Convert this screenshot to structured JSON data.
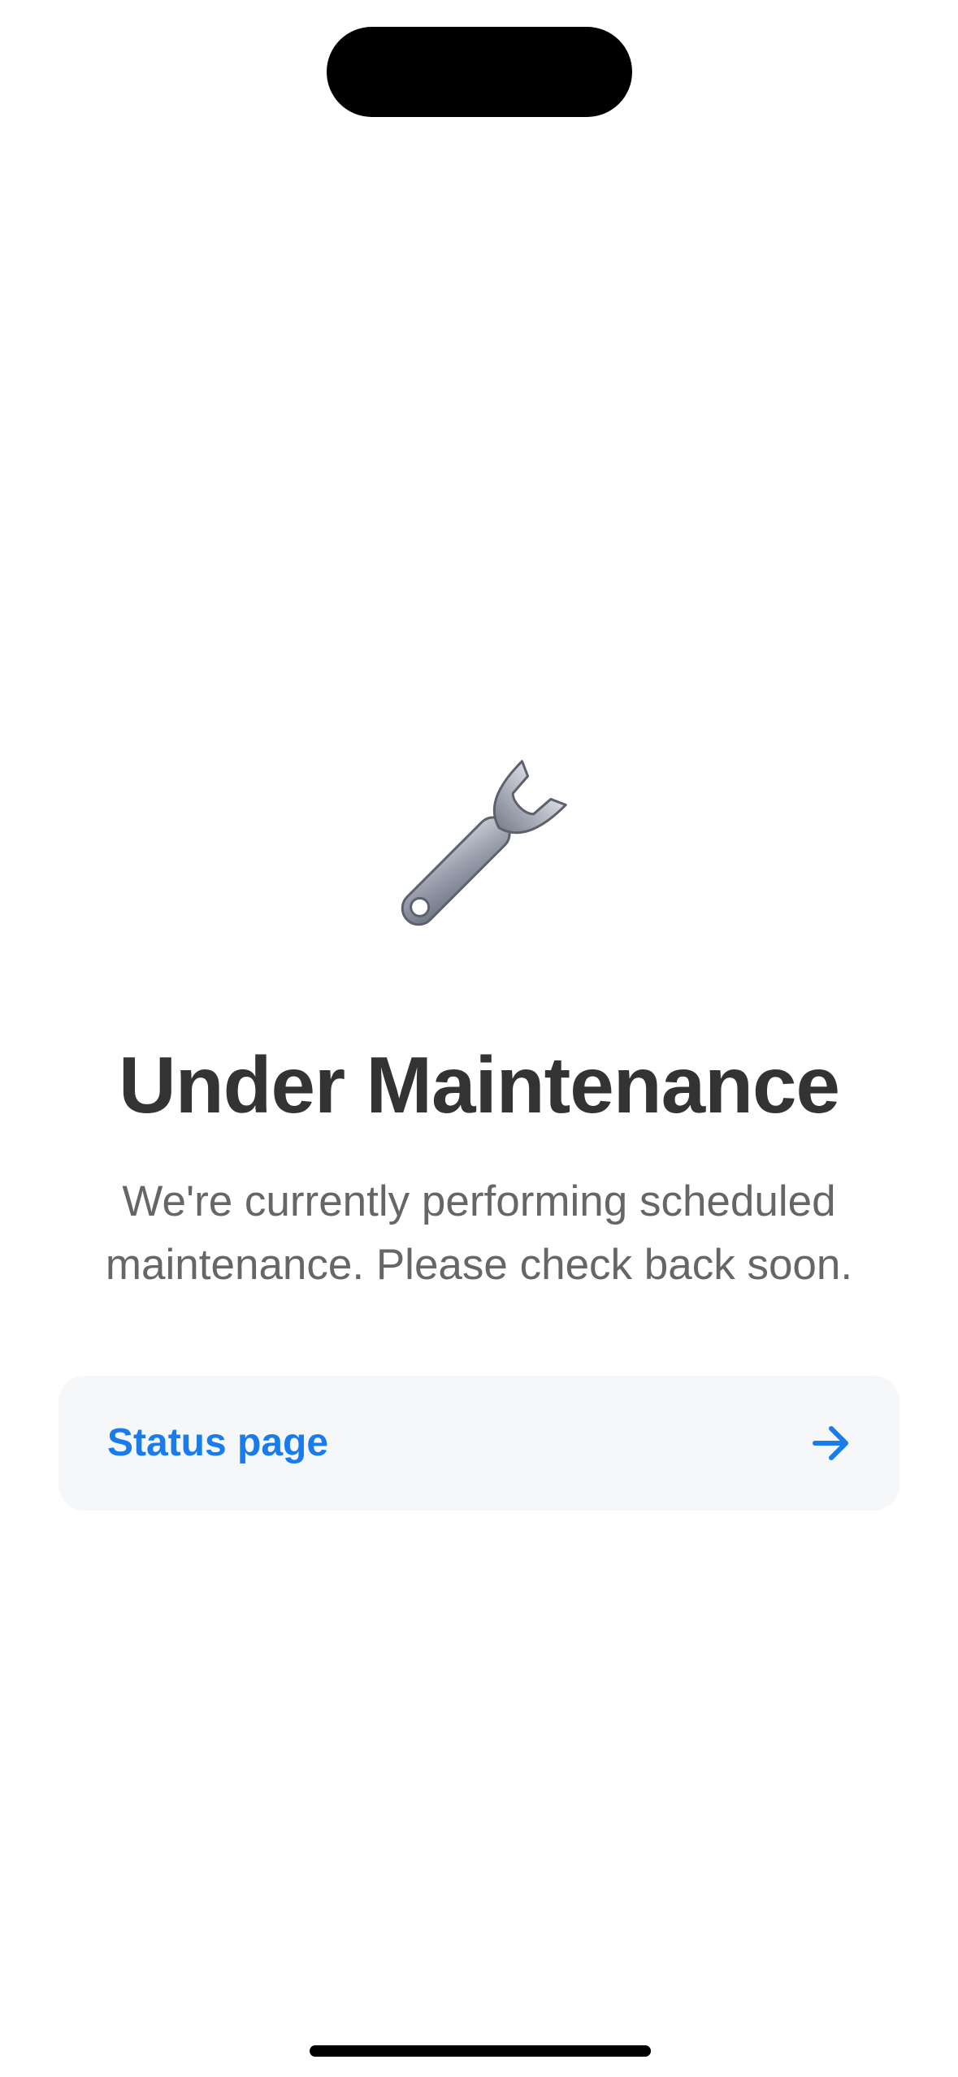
{
  "maintenance": {
    "icon": "wrench-icon",
    "title": "Under Maintenance",
    "message": "We're currently performing scheduled maintenance. Please check back soon."
  },
  "status_link": {
    "label": "Status page",
    "icon": "arrow-right-icon",
    "accent_color": "#1a7ceb"
  },
  "colors": {
    "title": "#333333",
    "message": "#666666",
    "card_background": "#f6f7f9"
  }
}
